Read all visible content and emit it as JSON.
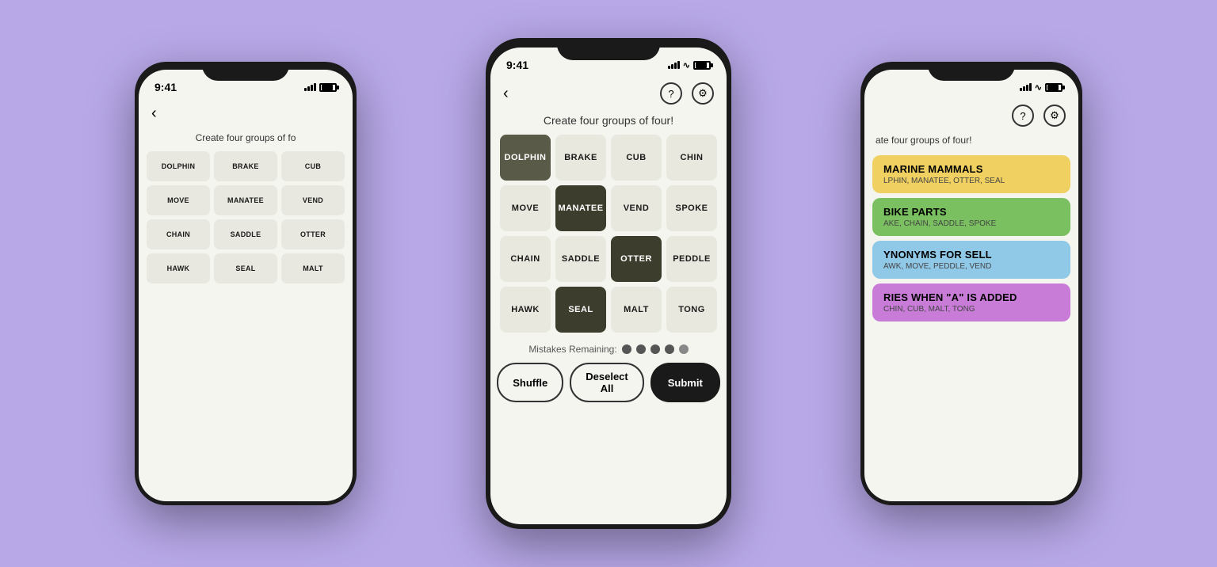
{
  "background_color": "#b8a8e8",
  "phones": {
    "center": {
      "status_time": "9:41",
      "subtitle": "Create four groups of four!",
      "grid": [
        {
          "word": "DOLPHIN",
          "state": "selected-dark"
        },
        {
          "word": "BRAKE",
          "state": "default"
        },
        {
          "word": "CUB",
          "state": "default"
        },
        {
          "word": "CHIN",
          "state": "default"
        },
        {
          "word": "MOVE",
          "state": "default"
        },
        {
          "word": "MANATEE",
          "state": "selected-darkest"
        },
        {
          "word": "VEND",
          "state": "default"
        },
        {
          "word": "SPOKE",
          "state": "default"
        },
        {
          "word": "CHAIN",
          "state": "default"
        },
        {
          "word": "SADDLE",
          "state": "default"
        },
        {
          "word": "OTTER",
          "state": "selected-darkest"
        },
        {
          "word": "PEDDLE",
          "state": "default"
        },
        {
          "word": "HAWK",
          "state": "default"
        },
        {
          "word": "SEAL",
          "state": "selected-darkest"
        },
        {
          "word": "MALT",
          "state": "default"
        },
        {
          "word": "TONG",
          "state": "default"
        }
      ],
      "mistakes_label": "Mistakes Remaining:",
      "mistakes_count": 4,
      "buttons": {
        "shuffle": "Shuffle",
        "deselect": "Deselect All",
        "submit": "Submit"
      }
    },
    "left": {
      "status_time": "9:41",
      "subtitle": "Create four groups of fo",
      "grid": [
        "DOLPHIN",
        "BRAKE",
        "CUB",
        "MOVE",
        "MANATEE",
        "VEND",
        "CHAIN",
        "SADDLE",
        "OTTER",
        "HAWK",
        "SEAL",
        "MALT"
      ]
    },
    "right": {
      "subtitle": "ate four groups of four!",
      "categories": [
        {
          "title": "MARINE MAMMALS",
          "words": "LPHIN, MANATEE, OTTER, SEAL",
          "color": "yellow"
        },
        {
          "title": "BIKE PARTS",
          "words": "AKE, CHAIN, SADDLE, SPOKE",
          "color": "green"
        },
        {
          "title": "YNONYMS FOR SELL",
          "words": "AWK, MOVE, PEDDLE, VEND",
          "color": "blue"
        },
        {
          "title": "RIES WHEN \"A\" IS ADDED",
          "words": "CHIN, CUB, MALT, TONG",
          "color": "purple"
        }
      ]
    }
  }
}
